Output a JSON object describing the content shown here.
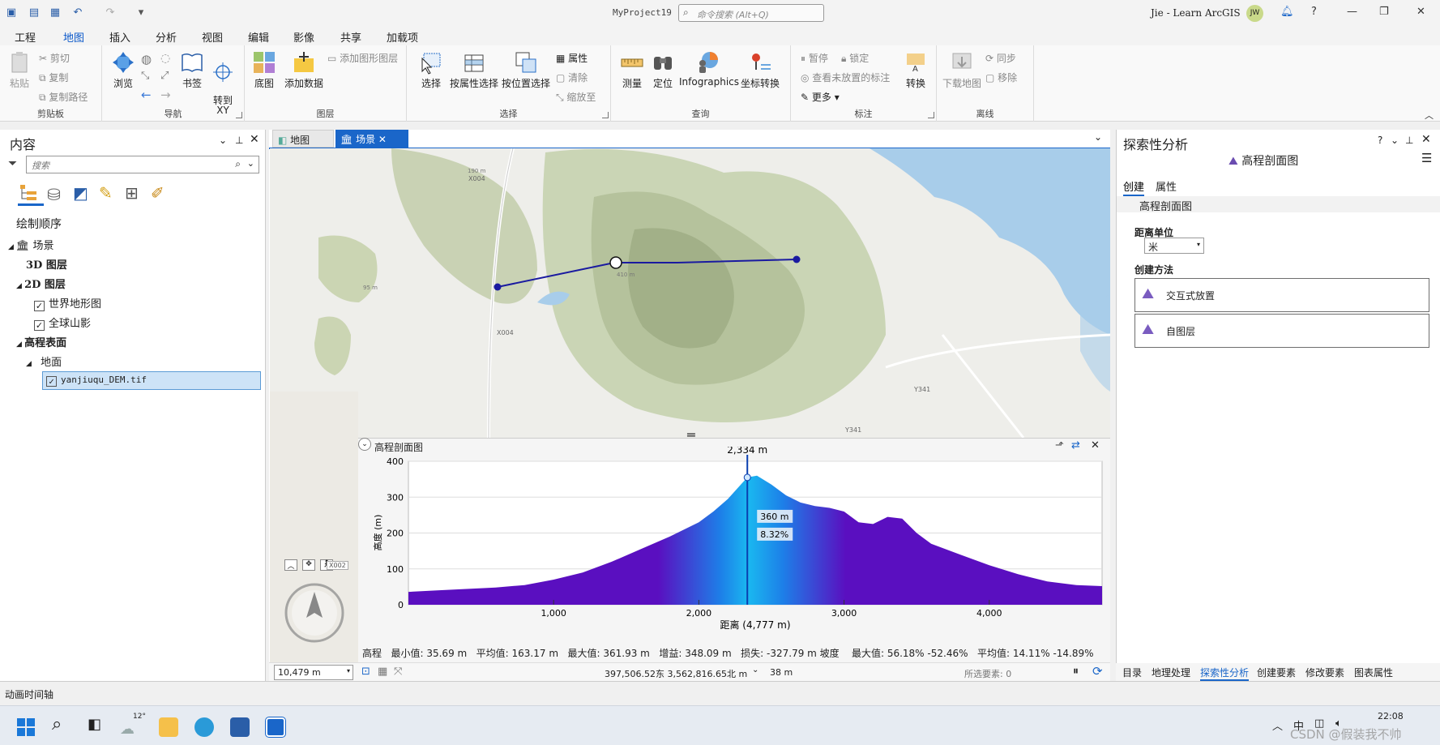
{
  "titlebar": {
    "project": "MyProject19",
    "search_placeholder": "命令搜索 (Alt+Q)",
    "user": "Jie - Learn ArcGIS",
    "avatar": "JW",
    "help": "?"
  },
  "menu": [
    "工程",
    "地图",
    "插入",
    "分析",
    "视图",
    "编辑",
    "影像",
    "共享",
    "加载项"
  ],
  "ribbon": {
    "clipboard": {
      "paste": "粘贴",
      "cut": "剪切",
      "copy": "复制",
      "copy_path": "复制路径",
      "label": "剪贴板"
    },
    "navigate": {
      "explore": "浏览",
      "bookmarks": "书签",
      "goto_xy": "转到\nXY",
      "label": "导航"
    },
    "layer": {
      "basemap": "底图",
      "add_data": "添加数据",
      "add_graphics": "添加图形图层",
      "label": "图层"
    },
    "selection": {
      "select": "选择",
      "by_attr": "按属性选择",
      "by_loc": "按位置选择",
      "attributes": "属性",
      "clear": "清除",
      "zoom_to": "缩放至",
      "label": "选择"
    },
    "inquiry": {
      "measure": "测量",
      "locate": "定位",
      "infographics": "Infographics",
      "coord": "坐标转换",
      "label": "查询"
    },
    "labeling": {
      "pause": "暂停",
      "lock": "锁定",
      "view_unplaced": "查看未放置的标注",
      "more": "更多",
      "convert": "转换",
      "label": "标注"
    },
    "offline": {
      "download": "下载地图",
      "sync": "同步",
      "remove": "移除",
      "label": "离线"
    }
  },
  "contents": {
    "title": "内容",
    "search_placeholder": "搜索",
    "drawing_order": "绘制顺序",
    "scene": "场景",
    "layers_3d": "3D 图层",
    "layers_2d": "2D 图层",
    "topo": "世界地形图",
    "hillshade": "全球山影",
    "elevation_surfaces": "高程表面",
    "ground": "地面",
    "dem": "yanjiuqu_DEM.tif"
  },
  "view_tabs": [
    "地图",
    "场景"
  ],
  "map_labels": {
    "x004a": "X004",
    "x004b": "X004",
    "y341a": "Y341",
    "y341b": "Y341",
    "x002": "X002",
    "elev190": "190 m",
    "elev410": "410 m",
    "elev95": "95 m"
  },
  "profile": {
    "title": "高程剖面图",
    "peak_label": "2,334 m",
    "cursor_elev": "360 m",
    "cursor_slope": "8.32%",
    "xlabel": "距离 (4,777 m)",
    "ylabel": "高度 (m)",
    "stats": {
      "elev_label": "高程",
      "min_label": "最小值:",
      "min": "35.69 m",
      "avg_label": "平均值:",
      "avg": "163.17 m",
      "max_label": "最大值:",
      "max": "361.93 m",
      "gain_label": "增益:",
      "gain": "348.09 m",
      "loss_label": "损失:",
      "loss": "-327.79 m",
      "slope_label": "坡度",
      "smax_label": "最大值:",
      "smax": "56.18%",
      "smax2": "-52.46%",
      "savg_label": "平均值:",
      "savg": "14.11%",
      "savg2": "-14.89%"
    }
  },
  "chart_data": {
    "type": "area",
    "xlabel": "距离 (4,777 m)",
    "ylabel": "高度 (m)",
    "xlim": [
      0,
      4777
    ],
    "ylim": [
      0,
      400
    ],
    "x_ticks": [
      "1,000",
      "2,000",
      "3,000",
      "4,000"
    ],
    "y_ticks": [
      "0",
      "100",
      "200",
      "300",
      "400"
    ],
    "x": [
      0,
      200,
      400,
      600,
      800,
      1000,
      1200,
      1400,
      1600,
      1800,
      2000,
      2100,
      2200,
      2300,
      2334,
      2400,
      2500,
      2600,
      2700,
      2800,
      2900,
      3000,
      3100,
      3200,
      3300,
      3400,
      3500,
      3600,
      3800,
      4000,
      4200,
      4400,
      4600,
      4777
    ],
    "y": [
      36,
      40,
      44,
      48,
      55,
      70,
      90,
      120,
      155,
      190,
      230,
      260,
      295,
      340,
      355,
      360,
      335,
      305,
      285,
      275,
      270,
      260,
      230,
      225,
      245,
      240,
      200,
      170,
      140,
      110,
      85,
      65,
      55,
      52
    ],
    "cursor_x": 2334
  },
  "status": {
    "scale": "10,479 m",
    "coords": "397,506.52东 3,562,816.65北 m",
    "elev": "38 m",
    "selected": "所选要素: 0"
  },
  "explore": {
    "title": "探索性分析",
    "subtitle": "高程剖面图",
    "tab_create": "创建",
    "tab_props": "属性",
    "section": "高程剖面图",
    "dist_unit_label": "距离单位",
    "dist_unit": "米",
    "method_label": "创建方法",
    "interactive": "交互式放置",
    "from_layer": "自图层"
  },
  "bottom_tabs": [
    "目录",
    "地理处理",
    "探索性分析",
    "创建要素",
    "修改要素",
    "图表属性"
  ],
  "anim": "动画时间轴",
  "taskbar": {
    "temp": "12°",
    "time": "22:08",
    "watermark": "CSDN @假装我不帅"
  }
}
